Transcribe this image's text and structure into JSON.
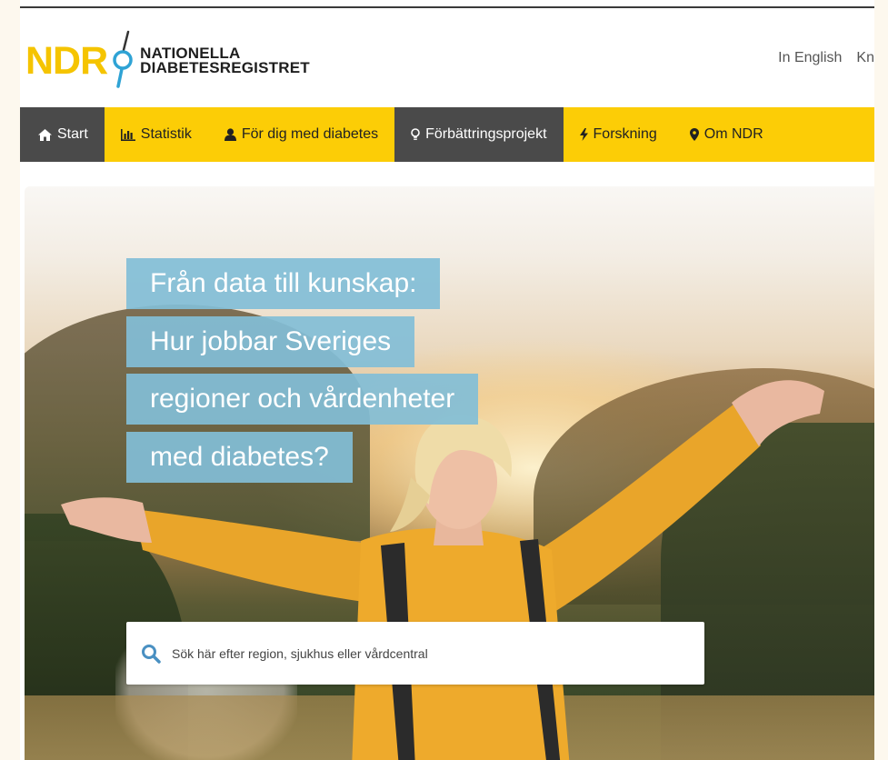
{
  "logo": {
    "abbr": "NDR",
    "line1": "NATIONELLA",
    "line2": "DIABETESREGISTRET",
    "brand_color": "#fccd06"
  },
  "header_links": {
    "english": "In English",
    "contact": "Kn"
  },
  "nav": {
    "items": [
      {
        "label": "Start",
        "icon": "home-icon"
      },
      {
        "label": "Statistik",
        "icon": "bar-chart-icon"
      },
      {
        "label": "För dig med diabetes",
        "icon": "user-icon"
      },
      {
        "label": "Förbättringsprojekt",
        "icon": "lightbulb-icon"
      },
      {
        "label": "Forskning",
        "icon": "bolt-icon"
      },
      {
        "label": "Om NDR",
        "icon": "map-marker-icon"
      }
    ]
  },
  "hero": {
    "lines": [
      "Från data till kunskap:",
      "Hur jobbar Sveriges",
      "regioner och vårdenheter",
      "med diabetes?"
    ]
  },
  "search": {
    "placeholder": "Sök här efter region, sjukhus eller vårdcentral"
  },
  "colors": {
    "nav_bg": "#fccd06",
    "nav_active_bg": "#4a4a4a",
    "headline_bg": "#82bed7",
    "search_icon": "#4a90c2"
  }
}
